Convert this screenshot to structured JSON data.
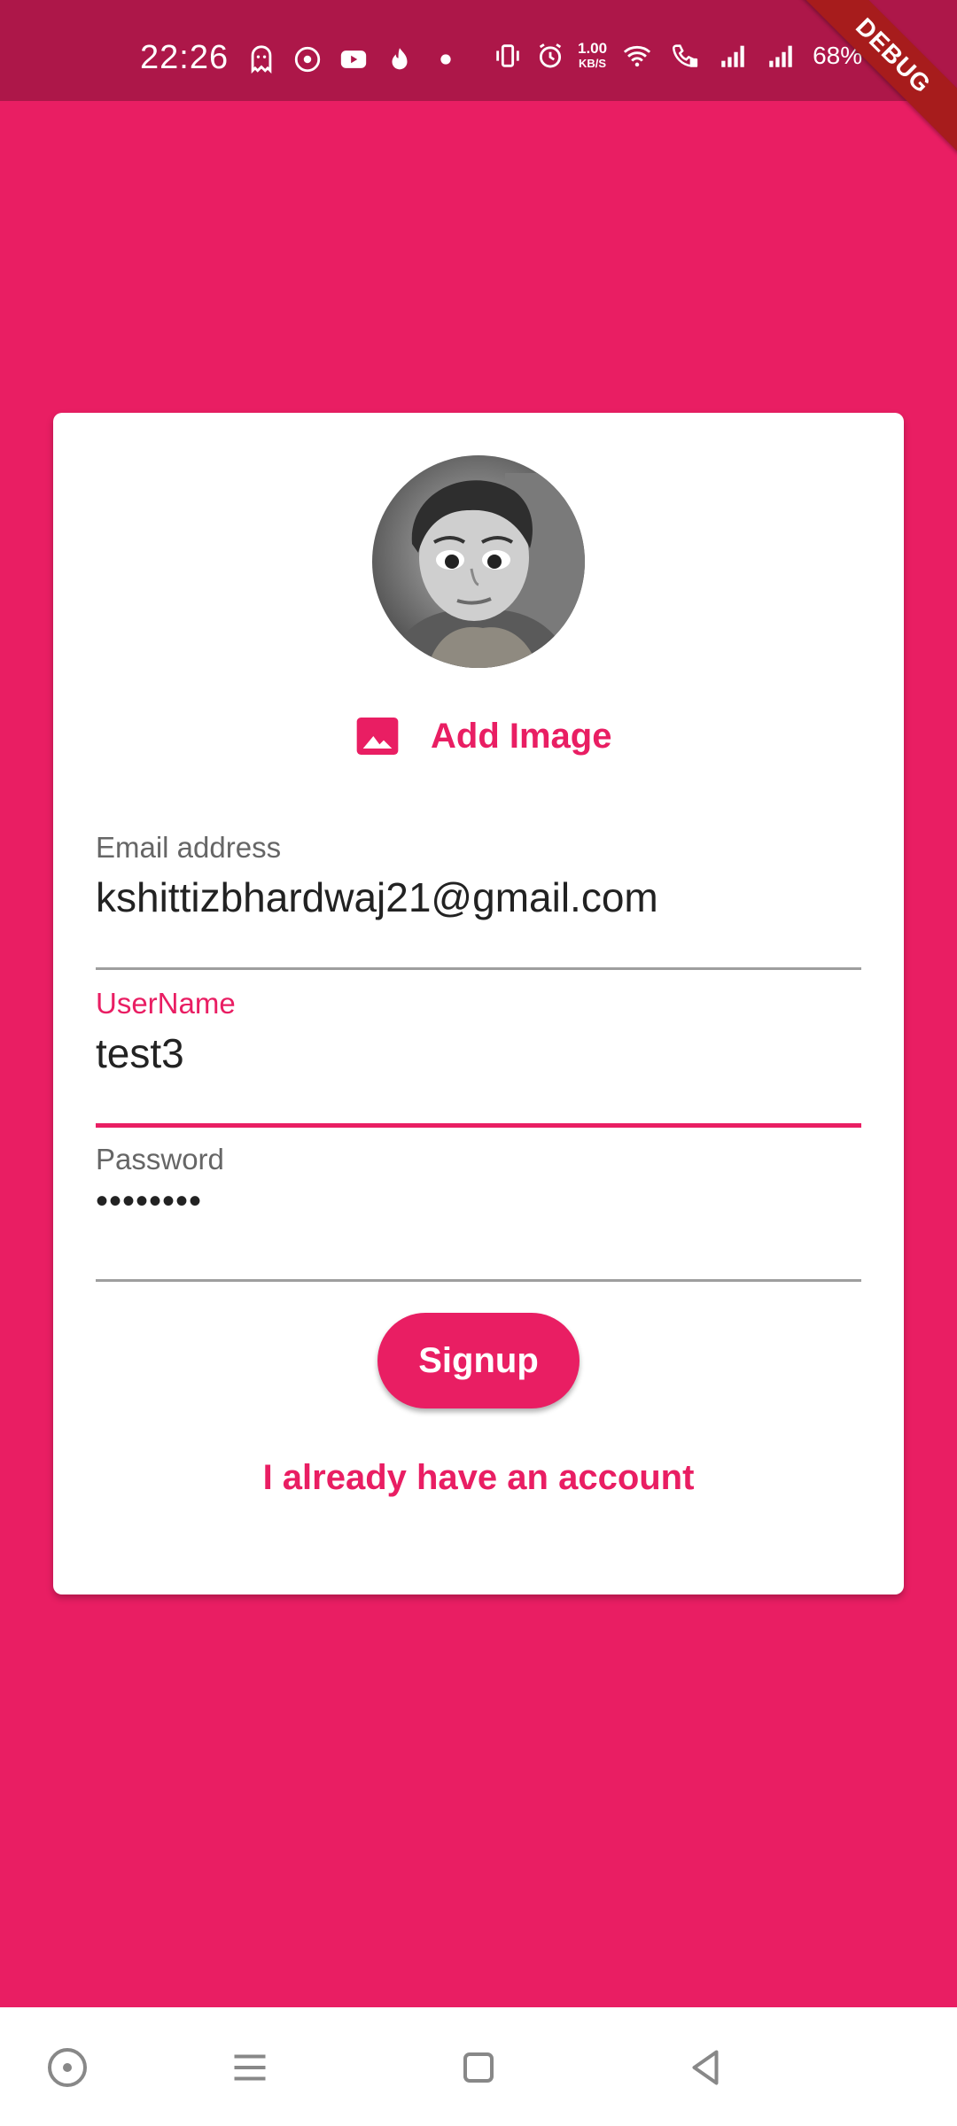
{
  "status_bar": {
    "time": "22:26",
    "left_icons": [
      "ghost-icon",
      "music-disc-icon",
      "youtube-icon",
      "flame-app-icon",
      "dot-icon"
    ],
    "right_icons": [
      "vibrate-icon",
      "alarm-icon",
      "wifi-icon",
      "wifi-call-icon",
      "signal-1-icon",
      "signal-2-icon"
    ],
    "net_speed_value": "1.00",
    "net_speed_unit": "KB/S",
    "battery": "68%"
  },
  "debug_banner": "DEBUG",
  "form": {
    "avatar_icon": "profile-photo",
    "add_image_label": "Add Image",
    "email": {
      "label": "Email address",
      "value": "kshittizbhardwaj21@gmail.com"
    },
    "username": {
      "label": "UserName",
      "value": "test3"
    },
    "password": {
      "label": "Password",
      "value": "••••••••"
    },
    "signup_label": "Signup",
    "login_link": "I already have an account"
  },
  "nav_bar": {
    "buttons": [
      "assistant-icon",
      "menu-icon",
      "home-icon",
      "back-icon"
    ]
  },
  "colors": {
    "primary": "#E91E63",
    "status_bar": "#AD1749",
    "card": "#FFFFFF"
  }
}
